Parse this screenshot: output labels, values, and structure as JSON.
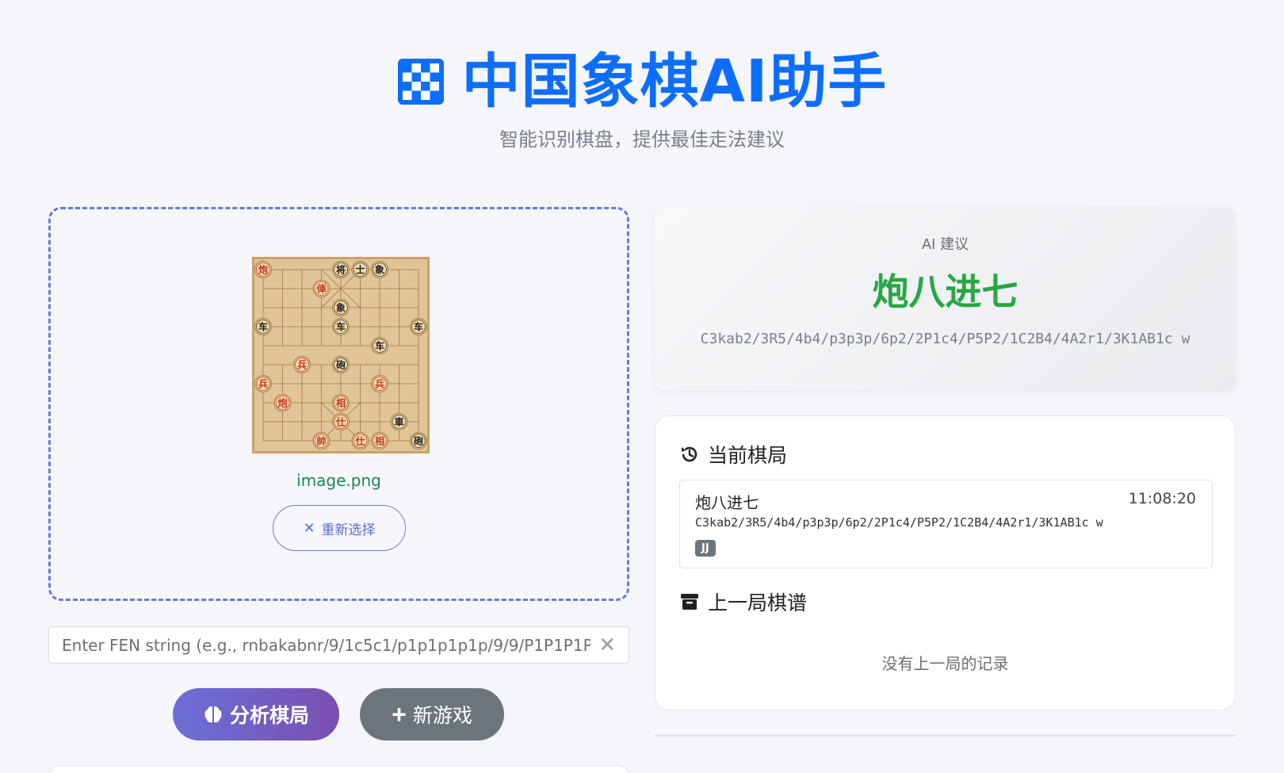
{
  "header": {
    "logo_icon": "chessboard-icon",
    "title": "中国象棋AI助手",
    "subtitle": "智能识别棋盘，提供最佳走法建议"
  },
  "upload": {
    "filename": "image.png",
    "reselect_label": "重新选择",
    "reselect_icon": "close-icon"
  },
  "fen_input": {
    "placeholder": "Enter FEN string (e.g., rnbakabnr/9/1c5c1/p1p1p1p1p/9/9/P1P1P1P1P/1C5C1/9/RNBAKABNR w)",
    "value": ""
  },
  "actions": {
    "analyze_label": "分析棋局",
    "analyze_icon": "brain-icon",
    "new_game_label": "新游戏",
    "new_game_icon": "plus-icon"
  },
  "ai_suggestion": {
    "label": "AI 建议",
    "move": "炮八进七",
    "fen": "C3kab2/3R5/4b4/p3p3p/6p2/2P1c4/P5P2/1C2B4/4A2r1/3K1AB1c w"
  },
  "current_game": {
    "heading": "当前棋局",
    "heading_icon": "history-icon",
    "moves": [
      {
        "name": "炮八进七",
        "time": "11:08:20",
        "fen": "C3kab2/3R5/4b4/p3p3p/6p2/2P1c4/P5P2/1C2B4/4A2r1/3K1AB1c w",
        "badge": "JJ"
      }
    ]
  },
  "previous_game": {
    "heading": "上一局棋谱",
    "heading_icon": "archive-icon",
    "empty_text": "没有上一局的记录"
  },
  "board_pieces": [
    {
      "ch": "炮",
      "side": "red"
    },
    {
      "ch": "将",
      "side": "black"
    },
    {
      "ch": "士",
      "side": "black"
    },
    {
      "ch": "象",
      "side": "black"
    },
    {
      "ch": "俥",
      "side": "red"
    },
    {
      "ch": "象",
      "side": "black"
    },
    {
      "ch": "车",
      "side": "black"
    },
    {
      "ch": "车",
      "side": "black"
    },
    {
      "ch": "车",
      "side": "black"
    },
    {
      "ch": "车",
      "side": "black"
    },
    {
      "ch": "兵",
      "side": "red"
    },
    {
      "ch": "砲",
      "side": "black"
    },
    {
      "ch": "兵",
      "side": "red"
    },
    {
      "ch": "兵",
      "side": "red"
    },
    {
      "ch": "炮",
      "side": "red"
    },
    {
      "ch": "相",
      "side": "red"
    },
    {
      "ch": "仕",
      "side": "red"
    },
    {
      "ch": "車",
      "side": "black"
    },
    {
      "ch": "帥",
      "side": "red"
    },
    {
      "ch": "仕",
      "side": "red"
    },
    {
      "ch": "相",
      "side": "red"
    },
    {
      "ch": "砲",
      "side": "black"
    }
  ],
  "colors": {
    "primary": "#0d6efd",
    "success": "#28a745",
    "file_green": "#198754",
    "dashed_border": "#6a7bd6",
    "analyze_gradient_start": "#6b6fd8",
    "analyze_gradient_end": "#7a4fb0",
    "secondary": "#6c757d"
  }
}
